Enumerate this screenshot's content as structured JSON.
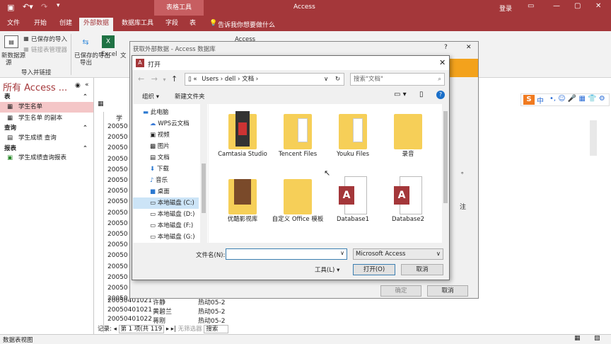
{
  "app": {
    "context_tab": "表格工具",
    "title": "Access",
    "login": "登录"
  },
  "menu": {
    "tabs": [
      "文件",
      "开始",
      "创建",
      "外部数据",
      "数据库工具",
      "字段",
      "表"
    ],
    "tell": "告诉我你想要做什么"
  },
  "ribbon": {
    "saved_imports": "已保存的导入",
    "linked_table_mgr": "链接表管理器",
    "new_source": "新数据源",
    "new_source2": "源",
    "saved_exports": "已保存的导出",
    "excel": "Excel",
    "text": "文",
    "group_import": "导入并链接",
    "access": "Access"
  },
  "nav": {
    "title": "所有 Access ...",
    "sec_tables": "表",
    "sec_queries": "查询",
    "sec_reports": "报表",
    "items": {
      "t1": "学生名单",
      "t2": "学生名单 的副本",
      "q1": "学生成绩 查询",
      "r1": "学生成绩查询报表"
    }
  },
  "table": {
    "col1": "学",
    "rows": [
      "20050",
      "20050",
      "20050",
      "20050",
      "20050",
      "20050",
      "20050",
      "20050",
      "20050",
      "20050",
      "20050",
      "20050",
      "20050",
      "20050",
      "20050",
      "20050",
      "20050"
    ],
    "row_a": {
      "id": "20050401021",
      "name": "许静",
      "class": "热动05-2"
    },
    "row_b": {
      "id": "20050401021",
      "name": "黄碧兰",
      "class": "热动05-2"
    },
    "row_c": {
      "id": "20050401022",
      "name": "蒋刚",
      "class": "热动05-2"
    },
    "record_label": "记录:",
    "record_value": "第 1 项(共 119",
    "filter": "无筛选器",
    "search": "搜索"
  },
  "status": {
    "view": "数据表视图"
  },
  "outer_dialog": {
    "title": "获取外部数据 - Access 数据库",
    "ok": "确定",
    "cancel": "取消",
    "frag1": "。",
    "frag2": "注"
  },
  "open_dialog": {
    "title": "打开",
    "path": [
      "Users",
      "dell",
      "文档"
    ],
    "search_placeholder": "搜索\"文档\"",
    "organize": "组织",
    "new_folder": "新建文件夹",
    "side": {
      "pc": "此电脑",
      "wps": "WPS云文档",
      "video": "视频",
      "pics": "图片",
      "docs": "文档",
      "downloads": "下载",
      "music": "音乐",
      "desktop": "桌面",
      "c": "本地磁盘 (C:)",
      "d": "本地磁盘 (D:)",
      "f": "本地磁盘 (F:)",
      "g": "本地磁盘 (G:)"
    },
    "files": [
      "Camtasia Studio",
      "Tencent Files",
      "Youku Files",
      "录音",
      "优酷影视库",
      "自定义 Office 模板",
      "Database1",
      "Database2"
    ],
    "filename_label": "文件名(N):",
    "filetype": "Microsoft Access",
    "tools": "工具(L)",
    "open": "打开(O)",
    "cancel": "取消"
  },
  "sogou": {
    "cn": "中"
  }
}
